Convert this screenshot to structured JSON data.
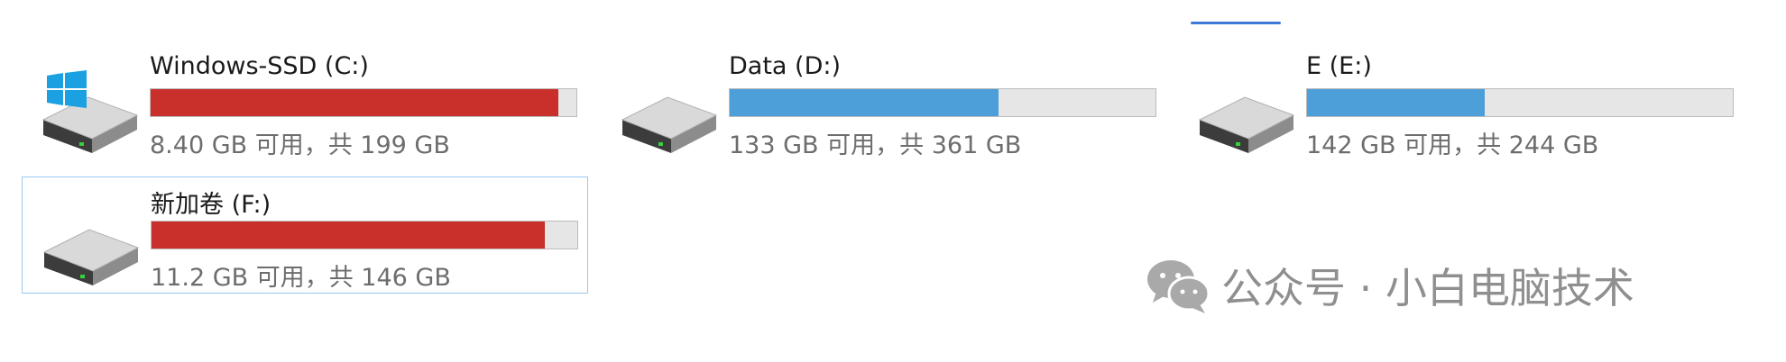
{
  "drives": [
    {
      "name": "Windows-SSD (C:)",
      "space": "8.40 GB 可用，共 199 GB",
      "used_fraction": 0.958,
      "bar_color": "#c9302c",
      "icon": "windows-drive-icon",
      "selected": false
    },
    {
      "name": "Data (D:)",
      "space": "133 GB 可用，共 361 GB",
      "used_fraction": 0.632,
      "bar_color": "#4d9fd9",
      "icon": "hard-drive-icon",
      "selected": false
    },
    {
      "name": "E (E:)",
      "space": "142 GB 可用，共 244 GB",
      "used_fraction": 0.418,
      "bar_color": "#4d9fd9",
      "icon": "hard-drive-icon",
      "selected": false
    },
    {
      "name": "新加卷 (F:)",
      "space": "11.2 GB 可用，共 146 GB",
      "used_fraction": 0.923,
      "bar_color": "#c9302c",
      "icon": "hard-drive-icon",
      "selected": true
    }
  ],
  "watermark": {
    "text": "公众号 · 小白电脑技术",
    "icon": "wechat-icon"
  }
}
